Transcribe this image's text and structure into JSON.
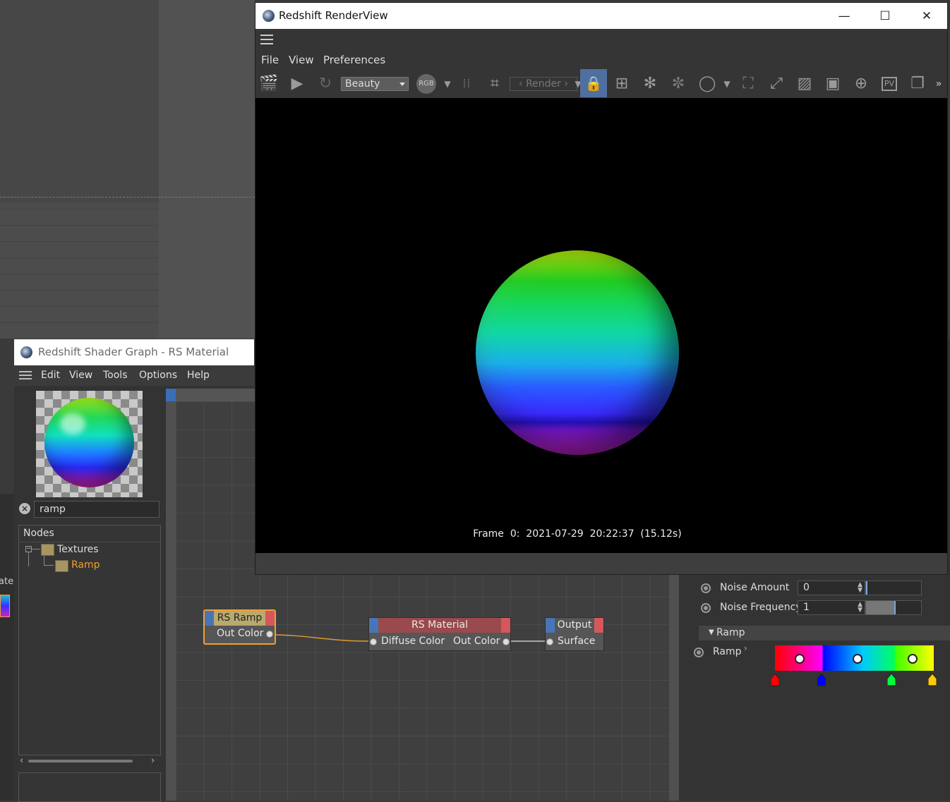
{
  "render_view": {
    "title": "Redshift RenderView",
    "window_controls": {
      "minimize": "—",
      "maximize": "☐",
      "close": "✕"
    },
    "menu": [
      "File",
      "View",
      "Preferences"
    ],
    "toolbar": {
      "aov_select": "Beauty",
      "rgb_label": "RGB",
      "render_nav": "‹ Render ›",
      "pv_label": "PV",
      "overflow": "»"
    },
    "frame_info": "Frame  0:  2021-07-29  20:22:37  (15.12s)"
  },
  "shader_graph": {
    "title": "Redshift Shader Graph - RS Material",
    "menu": [
      "Edit",
      "View",
      "Tools",
      "Options",
      "Help"
    ],
    "search": {
      "value": "ramp"
    },
    "nodes_panel": {
      "header": "Nodes",
      "tree": [
        {
          "label": "Textures",
          "type": "folder"
        },
        {
          "label": "Ramp",
          "type": "item",
          "highlight_color": "#f0a030"
        }
      ]
    },
    "graph_nodes": [
      {
        "title": "RS Ramp",
        "port": "Out Color",
        "header_color": "#b8a96e",
        "selected": true
      },
      {
        "title": "RS Material",
        "input": "Diffuse Color",
        "output": "Out Color",
        "header_color": "#9a4a4c"
      },
      {
        "title": "Output",
        "input": "Surface",
        "header_color": "#565656"
      }
    ],
    "attributes": {
      "noise_amount": {
        "label": "Noise Amount",
        "value": "0",
        "slider_fraction": 0.0
      },
      "noise_frequency": {
        "label": "Noise Frequency",
        "value": "1",
        "slider_fraction": 0.5
      },
      "section": "Ramp",
      "ramp_label": "Ramp",
      "ramp_stops": [
        {
          "color": "#ff0000",
          "position": 0.0
        },
        {
          "color": "#0000ff",
          "position": 0.3
        },
        {
          "color": "#00ff40",
          "position": 0.75
        },
        {
          "color": "#ffff00",
          "position": 1.0
        }
      ]
    }
  },
  "fragments": {
    "left_cut_text": "ate"
  },
  "colors": {
    "accent_orange": "#f0a030",
    "accent_blue": "#4874b8"
  }
}
